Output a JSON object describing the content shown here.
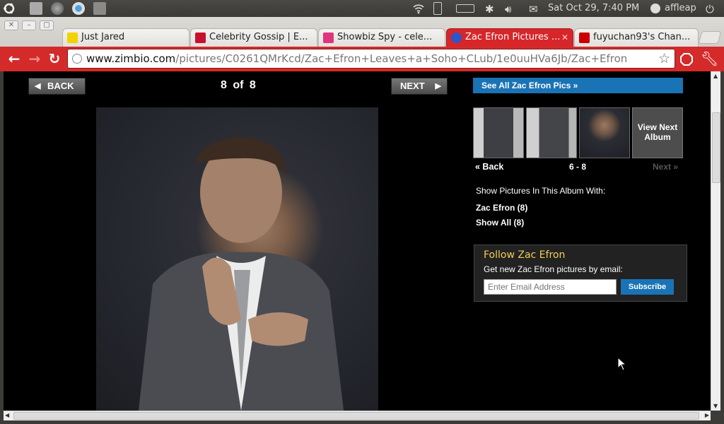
{
  "panel": {
    "datetime": "Sat Oct 29,  7:40 PM",
    "user": "affleap"
  },
  "tabs": [
    {
      "label": "Just Jared",
      "favicon_color": "#f2d200"
    },
    {
      "label": "Celebrity Gossip | E...",
      "favicon_color": "#c8102e"
    },
    {
      "label": "Showbiz Spy - cele...",
      "favicon_color": "#e0357d"
    },
    {
      "label": "Zac Efron Pictures ...",
      "favicon_color": "#2a57c9"
    },
    {
      "label": "fuyuchan93's Chan...",
      "favicon_color": "#c00"
    }
  ],
  "address": {
    "host": "www.zimbio.com",
    "path": "/pictures/C0261QMrKcd/Zac+Efron+Leaves+a+Soho+CLub/1e0uuHVa6Jb/Zac+Efron"
  },
  "gallery": {
    "back_label": "BACK",
    "next_label": "NEXT",
    "counter": "8 of 8"
  },
  "sidebar": {
    "see_all": "See All Zac Efron Pics »",
    "view_next": "View Next Album",
    "back": "« Back",
    "range": "6 - 8",
    "next": "Next »",
    "show_with": "Show Pictures In This Album With:",
    "filter_zac": "Zac Efron (8)",
    "filter_all": "Show All (8)"
  },
  "follow": {
    "title": "Follow Zac Efron",
    "subtitle": "Get new Zac Efron pictures by email:",
    "email_placeholder": "Enter Email Address",
    "subscribe_label": "Subscribe"
  },
  "colors": {
    "accent_red": "#d42a2a",
    "link_blue": "#1a73b5",
    "follow_title": "#f3cf52"
  }
}
